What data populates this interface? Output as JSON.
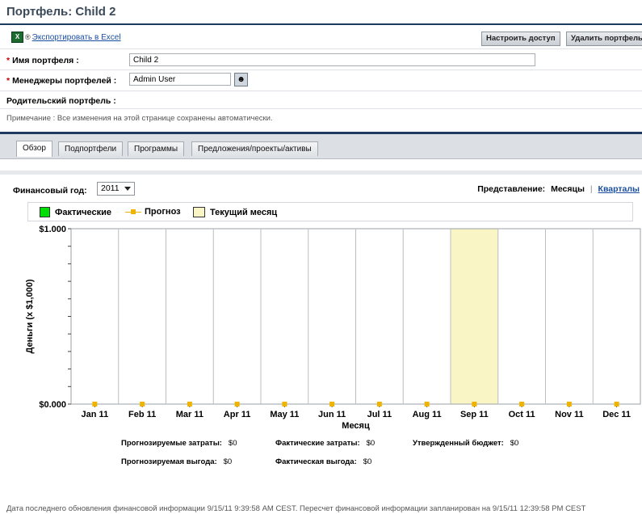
{
  "page": {
    "title": "Портфель: Child 2",
    "export_label": "Экспортировать в Excel",
    "buttons": {
      "access": "Настроить доступ",
      "delete": "Удалить портфель"
    }
  },
  "form": {
    "name_label": "Имя портфеля :",
    "name_value": "Child 2",
    "managers_label": "Менеджеры портфелей :",
    "managers_value": "Admin User",
    "parent_label": "Родительский портфель :",
    "note": "Примечание : Все изменения на этой странице сохранены автоматически."
  },
  "tabs": [
    "Обзор",
    "Подпортфели",
    "Программы",
    "Предложения/проекты/активы"
  ],
  "active_tab": "Обзор",
  "filters": {
    "fiscal_year_label": "Финансовый год:",
    "fiscal_year": "2011",
    "view_label": "Представление:",
    "view_months": "Месяцы",
    "view_quarters": "Кварталы"
  },
  "legend": {
    "actual": "Фактические",
    "forecast": "Прогноз",
    "current": "Текущий месяц"
  },
  "colors": {
    "actual": "#00dd00",
    "forecast": "#f0b400",
    "current_month": "#faf5c4",
    "accent": "#1f3a5f"
  },
  "chart_data": {
    "type": "line",
    "categories": [
      "Jan 11",
      "Feb 11",
      "Mar 11",
      "Apr 11",
      "May 11",
      "Jun 11",
      "Jul 11",
      "Aug 11",
      "Sep 11",
      "Oct 11",
      "Nov 11",
      "Dec 11"
    ],
    "series": [
      {
        "name": "Прогноз",
        "values": [
          0,
          0,
          0,
          0,
          0,
          0,
          0,
          0,
          0,
          0,
          0,
          0
        ]
      }
    ],
    "current_month": "Sep 11",
    "ylim": [
      0,
      1000
    ],
    "ytick_labels": [
      "$0.000",
      "$1.000"
    ],
    "xlabel": "Месяц",
    "ylabel": "Деньги (x $1,000)",
    "grid": true
  },
  "summary": {
    "forecast_cost_label": "Прогнозируемые затраты:",
    "forecast_cost": "$0",
    "actual_cost_label": "Фактические затраты:",
    "actual_cost": "$0",
    "approved_budget_label": "Утвержденный бюджет:",
    "approved_budget": "$0",
    "forecast_benefit_label": "Прогнозируемая выгода:",
    "forecast_benefit": "$0",
    "actual_benefit_label": "Фактическая выгода:",
    "actual_benefit": "$0"
  },
  "footer": "Дата последнего обновления финансовой информации 9/15/11 9:39:58 AM CEST. Пересчет финансовой информации запланирован на 9/15/11 12:39:58 PM CEST"
}
